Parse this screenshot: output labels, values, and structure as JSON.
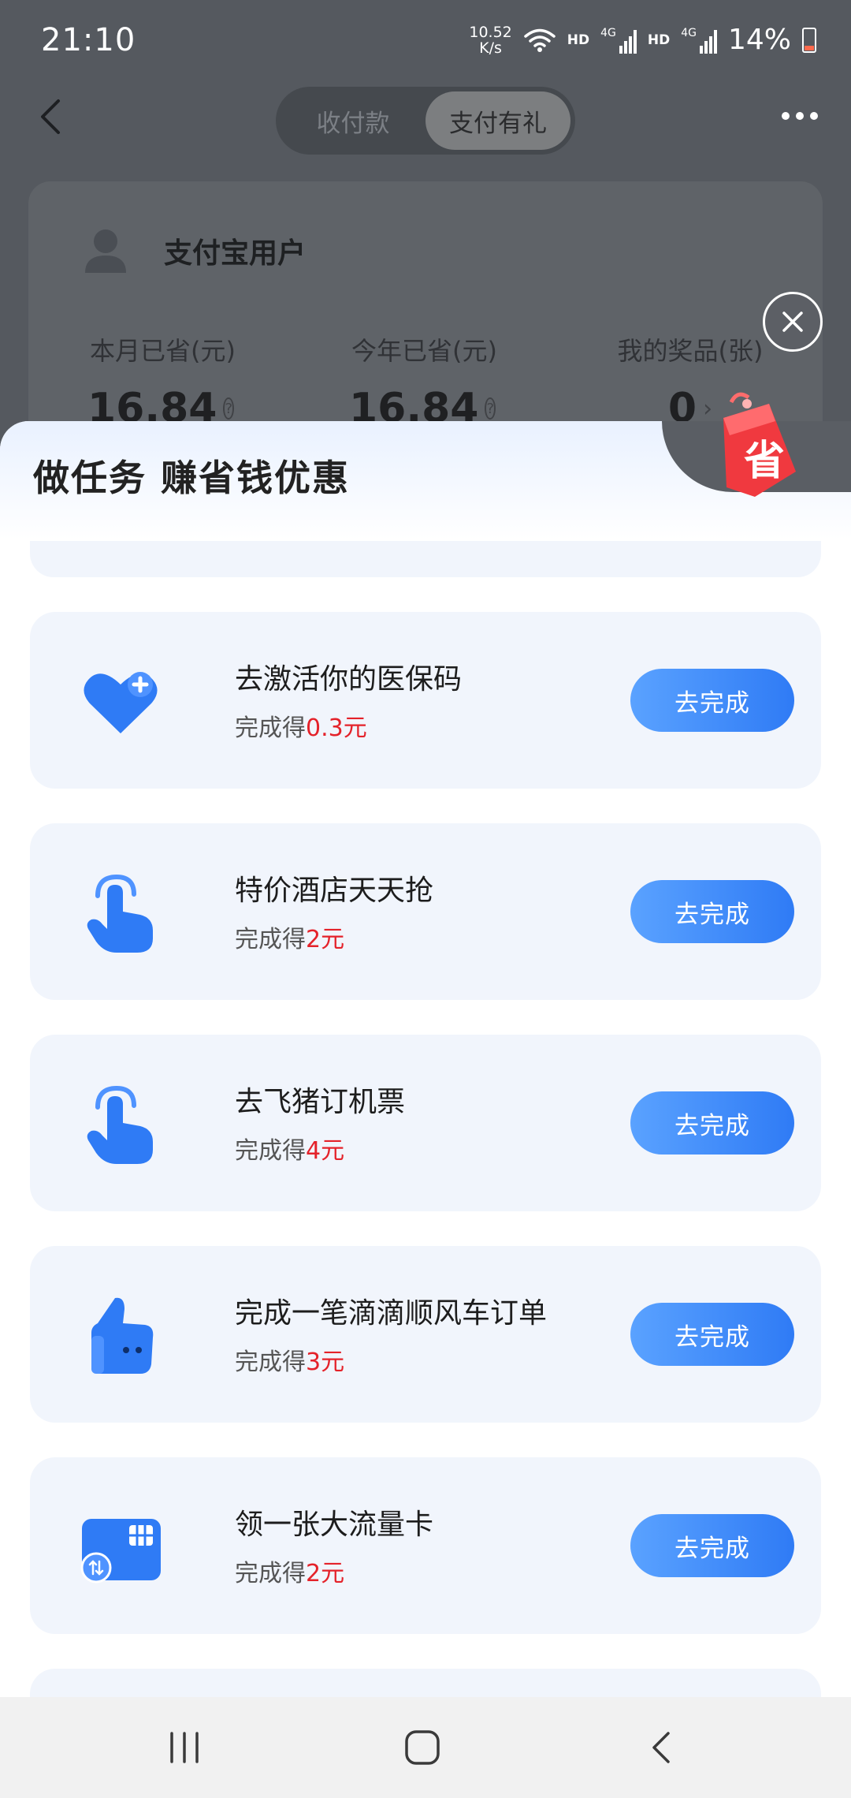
{
  "status_bar": {
    "time": "21:10",
    "net_speed_value": "10.52",
    "net_speed_unit": "K/s",
    "hd1": "HD",
    "hd2": "HD",
    "net1": "4G",
    "net2": "4G",
    "battery": "14%",
    "battery_level": 0.14,
    "battery_color": "#ff6a4d"
  },
  "header": {
    "tabs": [
      {
        "label": "收付款",
        "active": false
      },
      {
        "label": "支付有礼",
        "active": true
      }
    ]
  },
  "user_card": {
    "name": "支付宝用户",
    "stats": [
      {
        "label": "本月已省(元)",
        "value": "16.84",
        "help": "?"
      },
      {
        "label": "今年已省(元)",
        "value": "16.84",
        "help": "?"
      },
      {
        "label": "我的奖品(张)",
        "value": "0",
        "help": "›"
      }
    ]
  },
  "sheet": {
    "title": "做任务 赚省钱优惠",
    "badge_text": "省",
    "tasks": [
      {
        "title": "去激活你的医保码",
        "reward_prefix": "完成得",
        "reward_amount": "0.3元",
        "button": "去完成",
        "icon": "heart-plus-icon"
      },
      {
        "title": "特价酒店天天抢",
        "reward_prefix": "完成得",
        "reward_amount": "2元",
        "button": "去完成",
        "icon": "tap-hand-icon"
      },
      {
        "title": "去飞猪订机票",
        "reward_prefix": "完成得",
        "reward_amount": "4元",
        "button": "去完成",
        "icon": "tap-hand-icon"
      },
      {
        "title": "完成一笔滴滴顺风车订单",
        "reward_prefix": "完成得",
        "reward_amount": "3元",
        "button": "去完成",
        "icon": "thumbs-up-icon"
      },
      {
        "title": "领一张大流量卡",
        "reward_prefix": "完成得",
        "reward_amount": "2元",
        "button": "去完成",
        "icon": "sim-card-icon"
      }
    ]
  },
  "colors": {
    "accent": "#2f7bf5",
    "reward": "#e4222a",
    "card_bg": "#f1f5fc"
  }
}
